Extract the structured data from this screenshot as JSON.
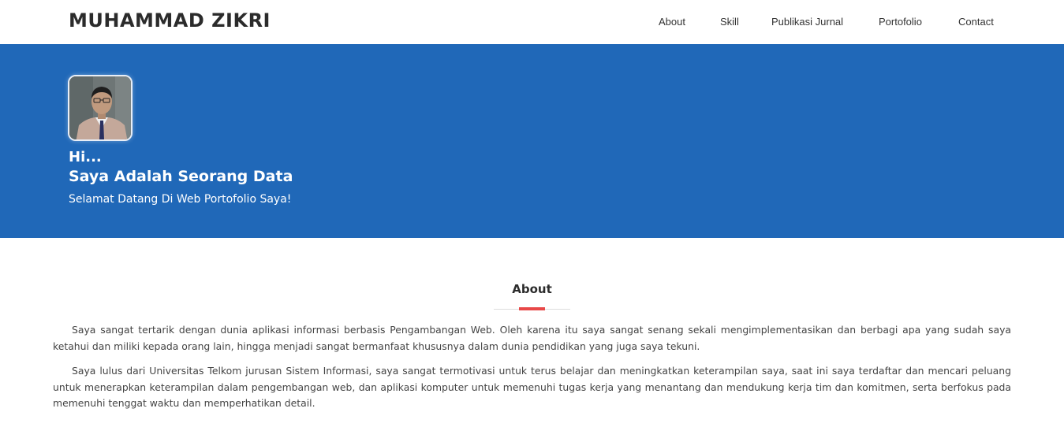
{
  "brand": "MUHAMMAD ZIKRI",
  "nav": {
    "about": "About",
    "skill": "Skill",
    "publikasi": "Publikasi Jurnal",
    "portofolio": "Portofolio",
    "contact": "Contact"
  },
  "hero": {
    "greeting": "Hi...",
    "tagline": "Saya Adalah Seorang Data",
    "welcome": "Selamat Datang Di Web Portofolio Saya!",
    "bg_color": "#2068b8"
  },
  "about": {
    "title": "About",
    "accent_color": "#e84848",
    "paragraph_1": "Saya sangat tertarik dengan dunia aplikasi informasi berbasis Pengambangan Web. Oleh karena itu saya sangat senang sekali mengimplementasikan dan berbagi apa yang sudah saya ketahui dan miliki kepada orang lain, hingga menjadi sangat bermanfaat khususnya dalam dunia pendidikan yang juga saya tekuni.",
    "paragraph_2": "Saya lulus dari Universitas Telkom jurusan Sistem Informasi, saya sangat termotivasi untuk terus belajar dan meningkatkan keterampilan saya, saat ini saya terdaftar dan mencari peluang untuk menerapkan keterampilan dalam pengembangan web, dan aplikasi komputer untuk memenuhi tugas kerja yang menantang dan mendukung kerja tim dan komitmen, serta berfokus pada memenuhi tenggat waktu dan memperhatikan detail."
  }
}
